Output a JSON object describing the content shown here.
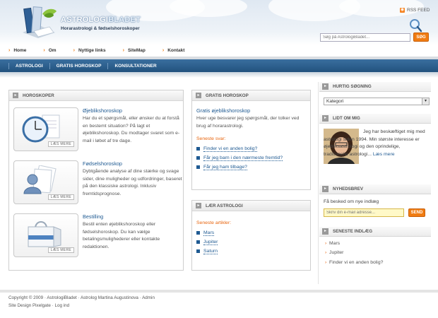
{
  "header": {
    "title_part1": "ASTROLOGI",
    "title_part2": "BLADET",
    "tagline": "Horarastrologi & fødselshoroskoper",
    "rss_label": "RSS FEED",
    "search_placeholder": "Søg på AstrologiBladet...",
    "search_button": "SØG",
    "rss_icon": "rss-icon",
    "magnifier_icon": "magnifier-icon"
  },
  "topnav": [
    "Home",
    "Om",
    "Nyttige links",
    "SiteMap",
    "Kontakt"
  ],
  "bluenav": [
    "ASTROLOGI",
    "GRATIS HOROSKOP",
    "KONSULTATIONER"
  ],
  "horoskoper": {
    "heading": "HOROSKOPER",
    "items": [
      {
        "title": "Øjeblikshoroskop",
        "desc": "Har du et spørgsmål, eller ønsker du at forstå en bestemt situation? På lagt et øjeblikshoroskop. Du modtager svaret som e-mail i løbet af tre dage.",
        "more": "LÆS MERE",
        "icon": "clock-icon"
      },
      {
        "title": "Fødselshoroskop",
        "desc": "Dybtgående analyse af dine stærke og svage sider, dine muligheder og udfordringer, baseret på den klassiske astrologi. Inklusiv fremtidsprognose.",
        "more": "LÆS MERE",
        "icon": "user-document-icon"
      },
      {
        "title": "Bestilling",
        "desc": "Bestil enten øjeblikshoroskop eller fødselshoroskop. Du kan vælge betalingsmulighederer eller kontakte redaktionen.",
        "more": "LÆS MERE",
        "icon": "shopping-bag-icon"
      }
    ]
  },
  "gratis": {
    "heading": "GRATIS HOROSKOP",
    "title": "Gratis øjeblikshoroskop",
    "desc": "Hver uge besvarer jeg spørgsmål, der tolker ved brug af horarastrologi.",
    "recent_label": "Seneste svar:",
    "links": [
      "Finder vi en anden bolig?",
      "Får jeg barn i den nærmeste fremtid?",
      "Får jeg ham tilbage?"
    ]
  },
  "laer": {
    "heading": "LÆR ASTROLOGI",
    "recent_label": "Seneste artikler:",
    "links": [
      "Mars",
      "Jupiter",
      "Saturn"
    ]
  },
  "sidebar": {
    "quick_heading": "HURTIG SØGNING",
    "category_value": "Kategori",
    "about_heading": "LIDT OM MIG",
    "about_text": "Jeg har beskæftiget mig med astrologi siden 1994. Min største interesse er øjebliksastrologi og den oprindelige, traditionelle astrologi...",
    "about_more": "Læs mere",
    "news_heading": "NYHEDSBREV",
    "news_label": "Få besked om nye indlæg",
    "news_placeholder": "Skriv din e-mail adresse...",
    "news_button": "SEND",
    "recent_heading": "SENESTE INDLÆG",
    "recent_items": [
      "Mars",
      "Jupiter",
      "Finder vi en anden bolig?"
    ]
  },
  "footer": {
    "line1": "Copyright © 2009 · AstrologiBladet · Astrolog Martina Augustinova · Admin",
    "line2": "Site Design Pixelgate · Log ind"
  },
  "colors": {
    "accent": "#f07c12",
    "nav_blue": "#22527e",
    "link_blue": "#1f5a92"
  }
}
